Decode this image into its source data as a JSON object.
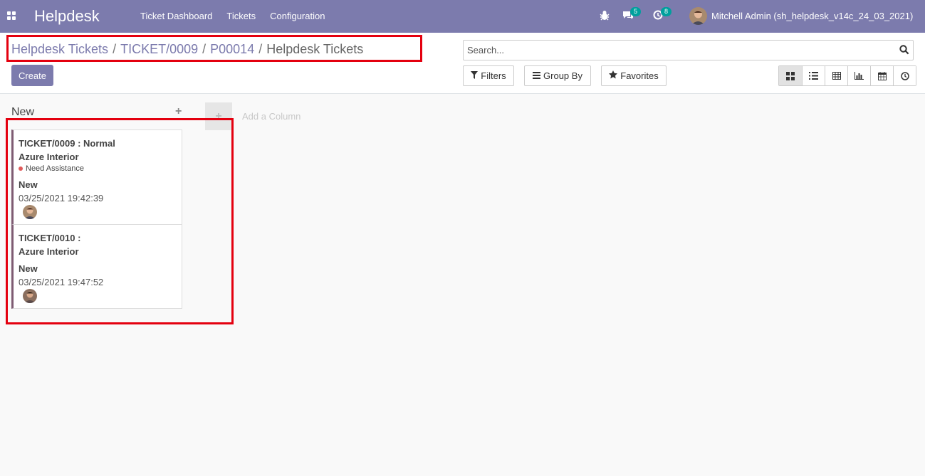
{
  "navbar": {
    "brand": "Helpdesk",
    "menu": [
      "Ticket Dashboard",
      "Tickets",
      "Configuration"
    ],
    "messages_count": "5",
    "activities_count": "8",
    "user": "Mitchell Admin (sh_helpdesk_v14c_24_03_2021)"
  },
  "breadcrumb": {
    "items": [
      "Helpdesk Tickets",
      "TICKET/0009",
      "P00014",
      "Helpdesk Tickets"
    ],
    "sep": "/"
  },
  "control": {
    "create_label": "Create",
    "search_placeholder": "Search...",
    "filters_label": "Filters",
    "groupby_label": "Group By",
    "favorites_label": "Favorites"
  },
  "kanban": {
    "column": "New",
    "add_column": "Add a Column",
    "cards": [
      {
        "title": "TICKET/0009 : Normal",
        "customer": "Azure Interior",
        "tag": "Need Assistance",
        "stage": "New",
        "date": "03/25/2021 19:42:39"
      },
      {
        "title": "TICKET/0010 :",
        "customer": "Azure Interior",
        "tag": "",
        "stage": "New",
        "date": "03/25/2021 19:47:52"
      }
    ]
  },
  "colors": {
    "brand": "#7c7bad",
    "highlight": "#e4000f",
    "badge": "#00a09d"
  }
}
